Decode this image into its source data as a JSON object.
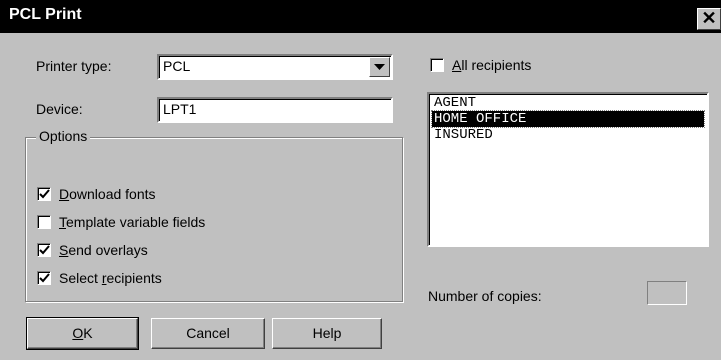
{
  "window": {
    "title": "PCL Print",
    "close_glyph": "✕"
  },
  "printer_type": {
    "label": "Printer type:",
    "value": "PCL"
  },
  "device": {
    "label": "Device:",
    "value": "LPT1"
  },
  "options": {
    "label": "Options",
    "items": [
      {
        "pre": "",
        "ul": "D",
        "post": "ownload fonts",
        "checked": true
      },
      {
        "pre": "",
        "ul": "T",
        "post": "emplate variable fields",
        "checked": false
      },
      {
        "pre": "",
        "ul": "S",
        "post": "end overlays",
        "checked": true
      },
      {
        "pre": "Select ",
        "ul": "r",
        "post": "ecipients",
        "checked": true
      }
    ]
  },
  "all_recipients": {
    "pre": "",
    "ul": "A",
    "post": "ll recipients",
    "checked": false
  },
  "recipients": [
    {
      "label": "AGENT",
      "selected": false
    },
    {
      "label": "HOME OFFICE",
      "selected": true
    },
    {
      "label": "INSURED",
      "selected": false
    }
  ],
  "copies": {
    "label": "Number of copies:",
    "value": ""
  },
  "buttons": {
    "ok": {
      "ul": "O",
      "post": "K"
    },
    "cancel": "Cancel",
    "help": "Help"
  }
}
